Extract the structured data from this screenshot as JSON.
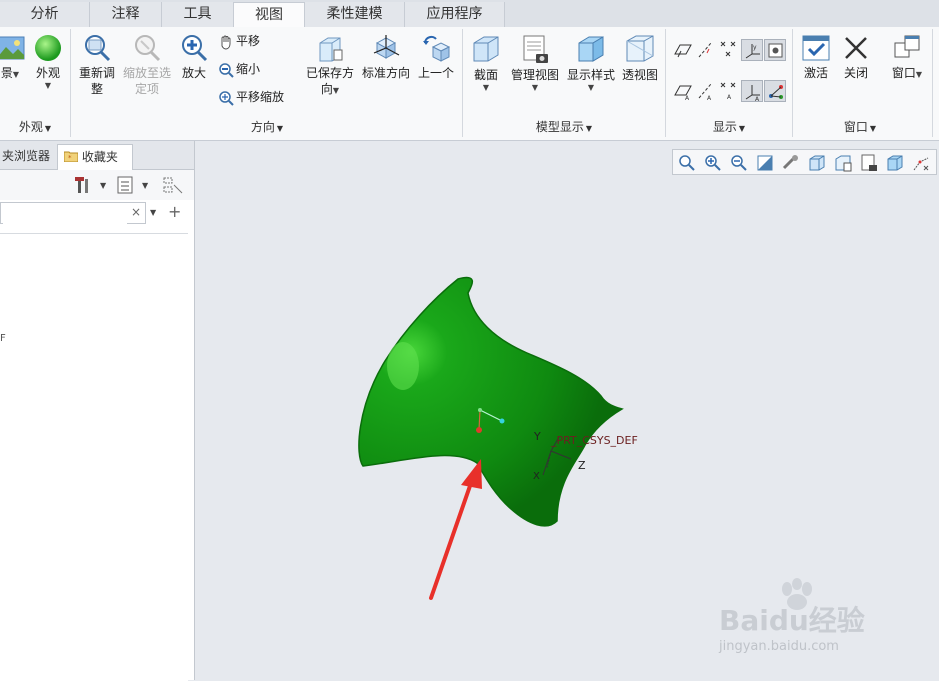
{
  "tabs": [
    {
      "label": "分析"
    },
    {
      "label": "注释"
    },
    {
      "label": "工具"
    },
    {
      "label": "视图"
    },
    {
      "label": "柔性建模"
    },
    {
      "label": "应用程序"
    }
  ],
  "active_tab": "视图",
  "groups": {
    "appearance": {
      "label": "外观",
      "scene_label": "景",
      "appearance_label": "外观"
    },
    "orientation": {
      "label": "方向",
      "refit": "重新调整",
      "refit_line1": "重新调",
      "refit_line2": "整",
      "zoom_to_selected_line1": "缩放至选",
      "zoom_to_selected_line2": "定项",
      "zoom_in": "放大",
      "pan": "平移",
      "zoom_out": "缩小",
      "pan_zoom": "平移缩放",
      "saved_orient_line1": "已保存方",
      "saved_orient_line2": "向",
      "standard_orient": "标准方向",
      "previous": "上一个"
    },
    "model_display": {
      "label": "模型显示",
      "section": "截面",
      "manage_views": "管理视图",
      "display_style": "显示样式",
      "perspective": "透视图"
    },
    "show": {
      "label": "显示"
    },
    "window": {
      "label": "窗口",
      "activate": "激活",
      "close": "关闭",
      "windows": "窗口"
    }
  },
  "left_panel": {
    "tabs": [
      "夹浏览器",
      "收藏夹"
    ],
    "search_value": "",
    "tree_fragment": "F"
  },
  "viewport": {
    "csys_label": "PRT_CSYS_DEF",
    "csys_prefix": "_",
    "axis_x": "X",
    "axis_y": "Y",
    "axis_z": "Z",
    "surface_color": "#0f8a10",
    "arrow_color": "#e8302a"
  },
  "watermark": {
    "brand": "Baidu经验",
    "url": "jingyan.baidu.com"
  }
}
